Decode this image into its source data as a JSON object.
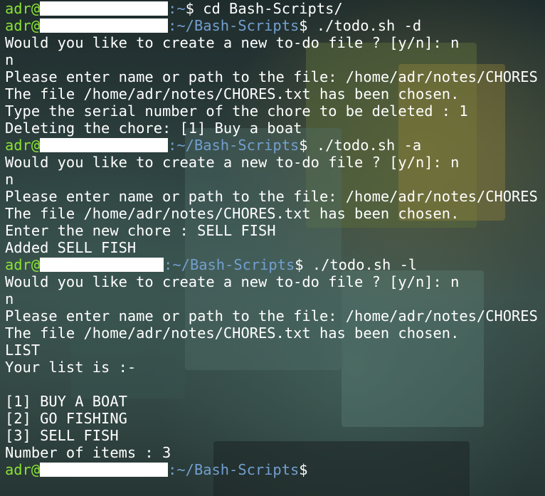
{
  "colors": {
    "prompt_user": "#8ae234",
    "prompt_path": "#729fcf",
    "text": "#ffffff",
    "redaction": "#ffffff"
  },
  "prompt": {
    "user": "adr@",
    "home_sep": ":~",
    "repo_path": ":~/Bash-Scripts",
    "symbol": "$"
  },
  "lines": [
    {
      "type": "prompt",
      "path": ":~",
      "command": " cd Bash-Scripts/"
    },
    {
      "type": "prompt",
      "path": ":~/Bash-Scripts",
      "command": " ./todo.sh -d"
    },
    {
      "type": "output",
      "text": "Would you like to create a new to-do file ? [y/n]: n"
    },
    {
      "type": "output",
      "text": "n"
    },
    {
      "type": "output",
      "text": "Please enter name or path to the file: /home/adr/notes/CHORES"
    },
    {
      "type": "output",
      "text": "The file /home/adr/notes/CHORES.txt has been chosen."
    },
    {
      "type": "output",
      "text": "Type the serial number of the chore to be deleted : 1"
    },
    {
      "type": "output",
      "text": "Deleting the chore: [1] Buy a boat"
    },
    {
      "type": "prompt",
      "path": ":~/Bash-Scripts",
      "command": " ./todo.sh -a"
    },
    {
      "type": "output",
      "text": "Would you like to create a new to-do file ? [y/n]: n"
    },
    {
      "type": "output",
      "text": "n"
    },
    {
      "type": "output",
      "text": "Please enter name or path to the file: /home/adr/notes/CHORES"
    },
    {
      "type": "output",
      "text": "The file /home/adr/notes/CHORES.txt has been chosen."
    },
    {
      "type": "output",
      "text": "Enter the new chore : SELL FISH"
    },
    {
      "type": "output",
      "text": "Added SELL FISH"
    },
    {
      "type": "prompt",
      "path": ":~/Bash-Scripts",
      "command": " ./todo.sh -l"
    },
    {
      "type": "output",
      "text": "Would you like to create a new to-do file ? [y/n]: n"
    },
    {
      "type": "output",
      "text": "n"
    },
    {
      "type": "output",
      "text": "Please enter name or path to the file: /home/adr/notes/CHORES"
    },
    {
      "type": "output",
      "text": "The file /home/adr/notes/CHORES.txt has been chosen."
    },
    {
      "type": "output",
      "text": "LIST"
    },
    {
      "type": "output",
      "text": "Your list is :-"
    },
    {
      "type": "output",
      "text": ""
    },
    {
      "type": "output",
      "text": "[1] BUY A BOAT"
    },
    {
      "type": "output",
      "text": "[2] GO FISHING"
    },
    {
      "type": "output",
      "text": "[3] SELL FISH"
    },
    {
      "type": "output",
      "text": "Number of items : 3"
    },
    {
      "type": "prompt",
      "path": ":~/Bash-Scripts",
      "command": ""
    }
  ]
}
